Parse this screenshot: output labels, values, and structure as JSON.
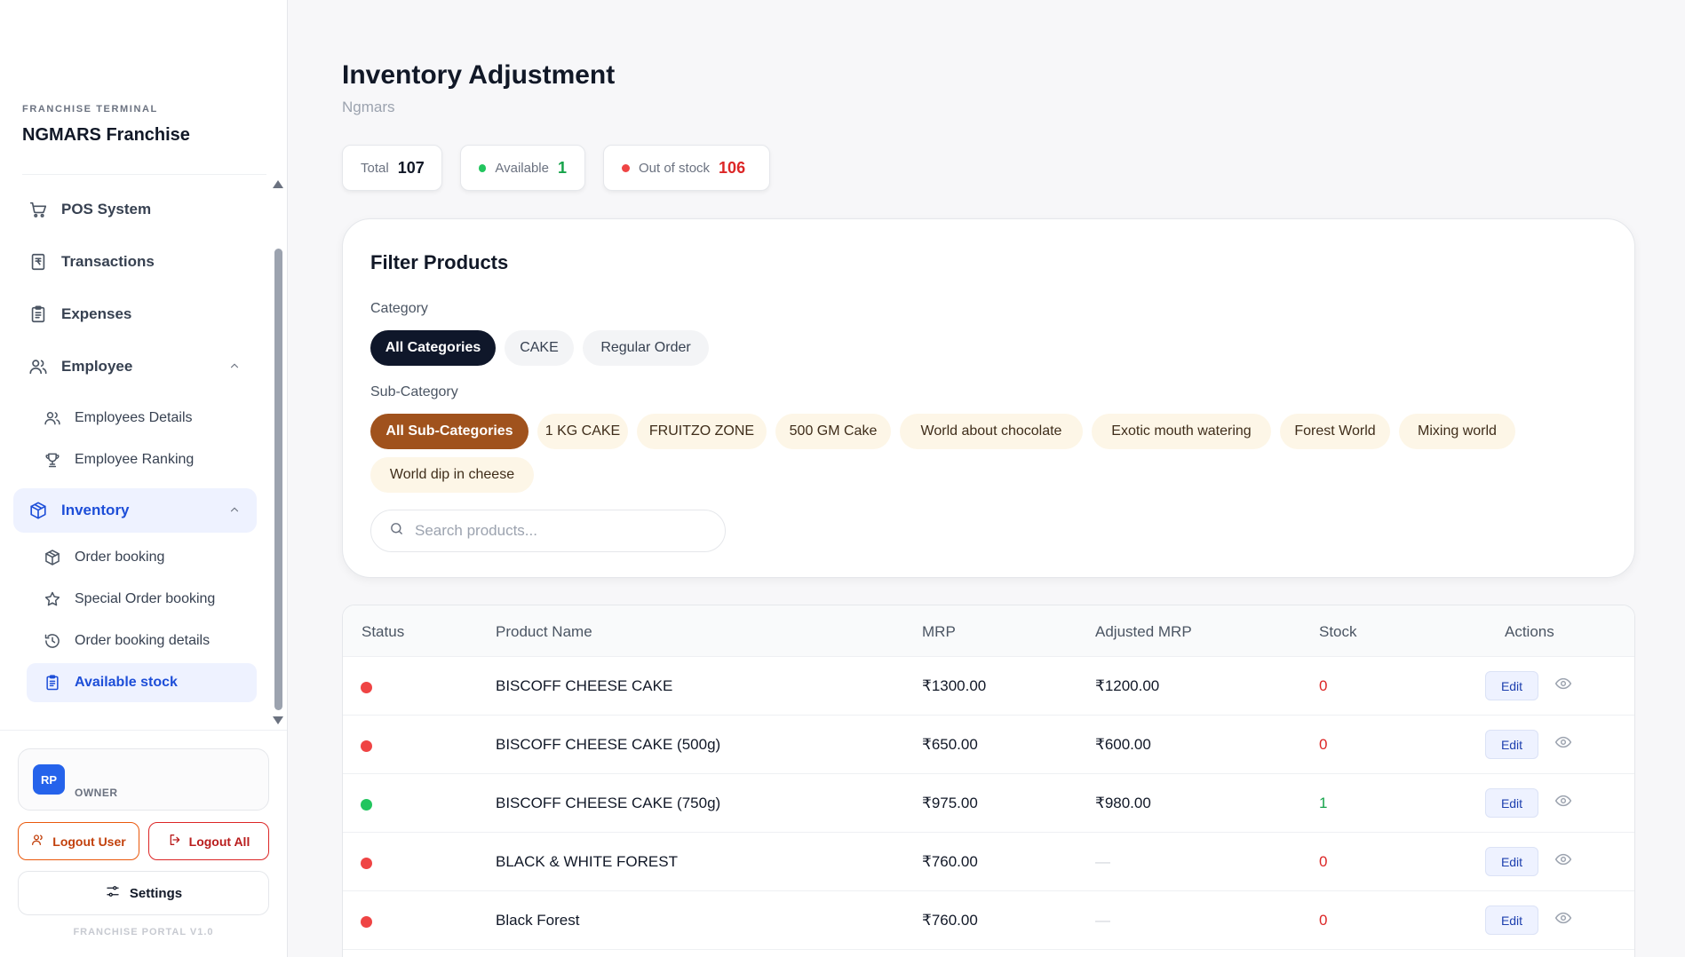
{
  "brand": {
    "kicker": "FRANCHISE TERMINAL",
    "name": "NGMARS Franchise"
  },
  "nav": {
    "pos": "POS System",
    "transactions": "Transactions",
    "expenses": "Expenses",
    "employee": "Employee",
    "employee_sub": [
      "Employees Details",
      "Employee Ranking"
    ],
    "inventory": "Inventory",
    "inventory_sub": [
      "Order booking",
      "Special Order booking",
      "Order booking details",
      "Available stock"
    ]
  },
  "user": {
    "initials": "RP",
    "role": "OWNER"
  },
  "buttons": {
    "logout_user": "Logout User",
    "logout_all": "Logout All",
    "settings": "Settings"
  },
  "version": "FRANCHISE PORTAL V1.0",
  "page": {
    "title": "Inventory Adjustment",
    "subtitle": "Ngmars"
  },
  "stats": {
    "total_label": "Total",
    "total": "107",
    "available_label": "Available",
    "available": "1",
    "oos_label": "Out of stock",
    "oos": "106"
  },
  "filters": {
    "title": "Filter Products",
    "category_label": "Category",
    "categories": [
      "All Categories",
      "CAKE",
      "Regular Order"
    ],
    "subcategory_label": "Sub-Category",
    "subcategories": [
      "All Sub-Categories",
      "1 KG CAKE",
      "FRUITZO ZONE",
      "500 GM Cake",
      "World about chocolate",
      "Exotic mouth watering",
      "Forest World",
      "Mixing world",
      "World dip in cheese"
    ],
    "search_placeholder": "Search products..."
  },
  "table": {
    "headers": [
      "Status",
      "Product Name",
      "MRP",
      "Adjusted MRP",
      "Stock",
      "Actions"
    ],
    "rows": [
      {
        "name": "BISCOFF CHEESE CAKE",
        "mrp": "₹1300.00",
        "adjusted": "₹1200.00",
        "stock": "0",
        "edit": "Edit"
      },
      {
        "name": "BISCOFF CHEESE CAKE (500g)",
        "mrp": "₹650.00",
        "adjusted": "₹600.00",
        "stock": "0",
        "edit": "Edit"
      },
      {
        "name": "BISCOFF CHEESE CAKE (750g)",
        "mrp": "₹975.00",
        "adjusted": "₹980.00",
        "stock": "1",
        "edit": "Edit"
      },
      {
        "name": "BLACK & WHITE FOREST",
        "mrp": "₹760.00",
        "adjusted": "—",
        "stock": "0",
        "edit": "Edit"
      },
      {
        "name": "Black Forest",
        "mrp": "₹760.00",
        "adjusted": "—",
        "stock": "0",
        "edit": "Edit"
      }
    ]
  },
  "colors": {
    "accent": "#1d4ed8",
    "out": "#ef4444",
    "in": "#22c55e",
    "brown": "#a0521d",
    "dark": "#0f172a"
  }
}
